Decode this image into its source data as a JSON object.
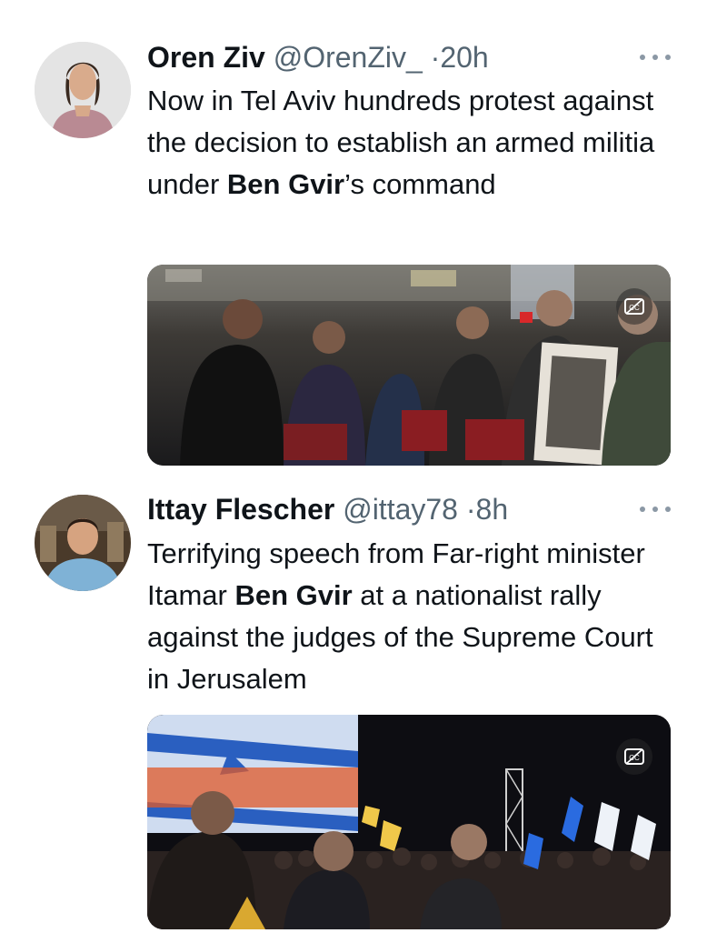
{
  "tweets": [
    {
      "name": "Oren Ziv",
      "handle": "@OrenZiv_",
      "separator": "·",
      "time": "20h",
      "text_parts": [
        "Now in Tel Aviv hundreds protest against the decision to establish an armed militia under ",
        "Ben Gvir",
        "’s command"
      ],
      "media_icon": "closed-captions-icon"
    },
    {
      "name": "Ittay Flescher",
      "handle": "@ittay78",
      "separator": "·",
      "time": "8h",
      "text_parts": [
        "Terrifying speech from Far-right minister Itamar ",
        "Ben Gvir",
        " at a nationalist rally against the judges of the Supreme Court in Jerusalem"
      ],
      "media_icon": "closed-captions-icon"
    }
  ],
  "icons": {
    "more": "more-options-icon"
  },
  "colors": {
    "primary_text": "#0f1419",
    "secondary_text": "#536471"
  }
}
